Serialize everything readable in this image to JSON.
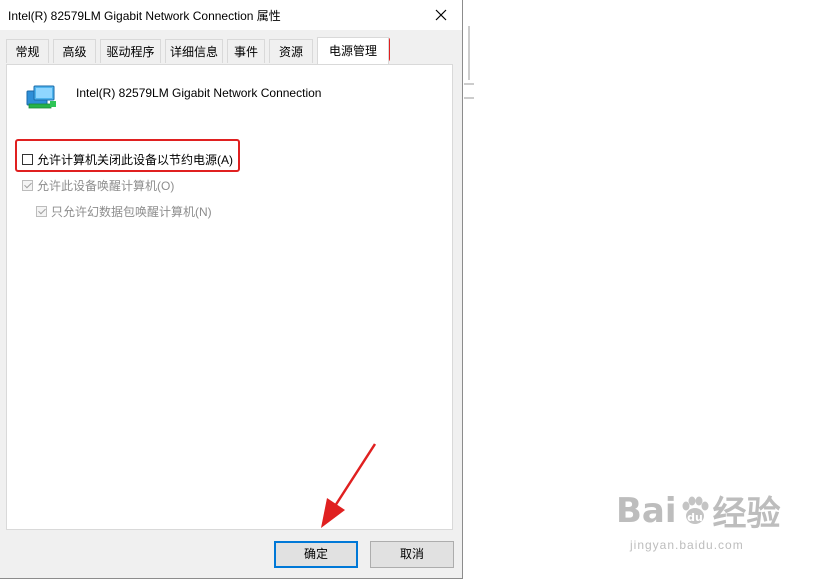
{
  "window": {
    "title": "Intel(R) 82579LM Gigabit Network Connection 属性"
  },
  "tabs": [
    {
      "label": "常规"
    },
    {
      "label": "高级"
    },
    {
      "label": "驱动程序"
    },
    {
      "label": "详细信息"
    },
    {
      "label": "事件"
    },
    {
      "label": "资源"
    },
    {
      "label": "电源管理"
    }
  ],
  "active_tab": "电源管理",
  "device": {
    "name": "Intel(R) 82579LM Gigabit Network Connection",
    "icon": "network-adapter-icon"
  },
  "options": [
    {
      "label": "允许计算机关闭此设备以节约电源(A)",
      "checked": false,
      "enabled": true
    },
    {
      "label": "允许此设备唤醒计算机(O)",
      "checked": true,
      "enabled": false
    },
    {
      "label": "只允许幻数据包唤醒计算机(N)",
      "checked": true,
      "enabled": false
    }
  ],
  "buttons": {
    "ok": "确定",
    "cancel": "取消"
  },
  "annotation_color": "#e02020",
  "watermark": {
    "brand_left": "Bai",
    "brand_right": "经验",
    "url": "jingyan.baidu.com"
  }
}
